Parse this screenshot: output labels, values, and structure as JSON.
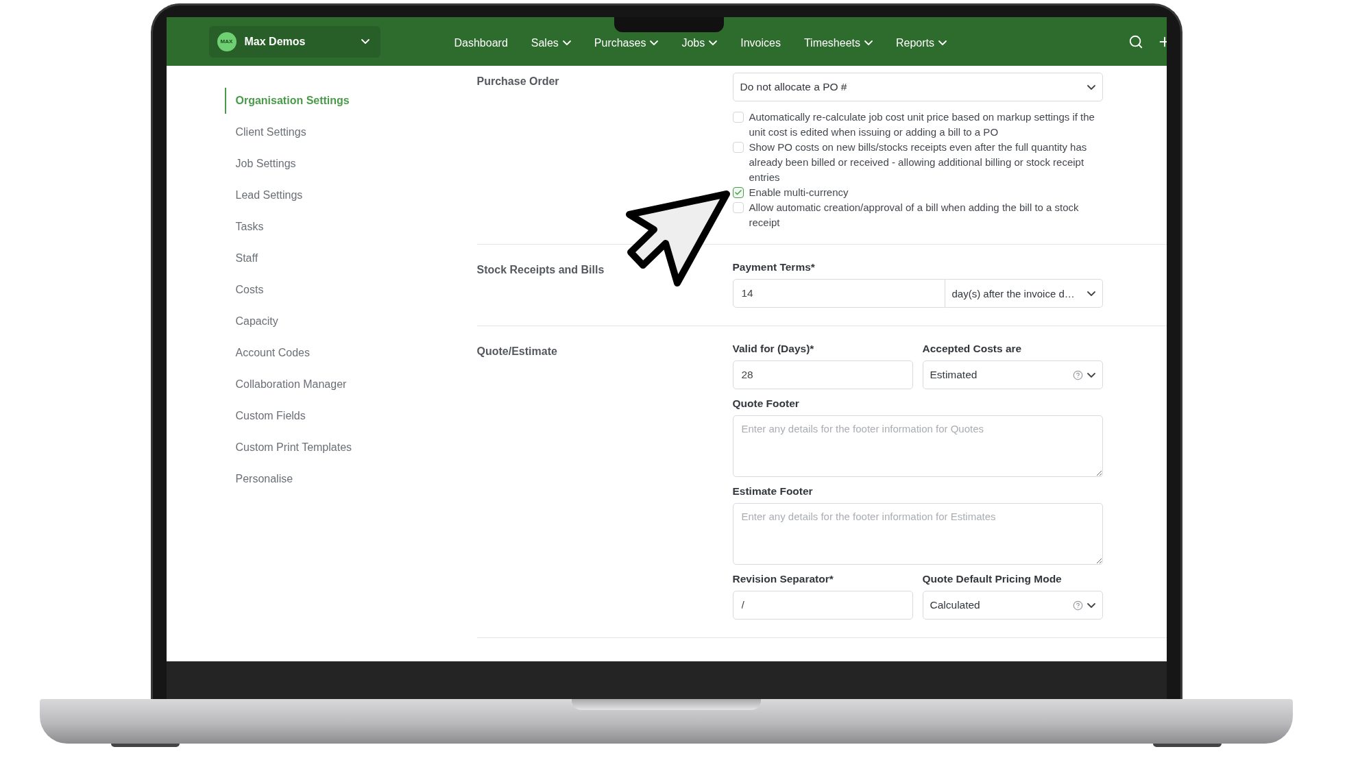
{
  "topbar": {
    "org_switcher": {
      "logo_text": "MAX",
      "name": "Max Demos"
    },
    "nav": [
      {
        "label": "Dashboard",
        "dropdown": false,
        "selected": false
      },
      {
        "label": "Sales",
        "dropdown": true,
        "selected": false
      },
      {
        "label": "Purchases",
        "dropdown": true,
        "selected": false
      },
      {
        "label": "Jobs",
        "dropdown": true,
        "selected": false
      },
      {
        "label": "Invoices",
        "dropdown": false,
        "selected": false
      },
      {
        "label": "Timesheets",
        "dropdown": true,
        "selected": false
      },
      {
        "label": "Reports",
        "dropdown": true,
        "selected": false
      }
    ]
  },
  "sidebar": {
    "items": [
      {
        "label": "Organisation Settings",
        "selected": true
      },
      {
        "label": "Client Settings",
        "selected": false
      },
      {
        "label": "Job Settings",
        "selected": false
      },
      {
        "label": "Lead Settings",
        "selected": false
      },
      {
        "label": "Tasks",
        "selected": false
      },
      {
        "label": "Staff",
        "selected": false
      },
      {
        "label": "Costs",
        "selected": false
      },
      {
        "label": "Capacity",
        "selected": false
      },
      {
        "label": "Account Codes",
        "selected": false
      },
      {
        "label": "Collaboration Manager",
        "selected": false
      },
      {
        "label": "Custom Fields",
        "selected": false
      },
      {
        "label": "Custom Print Templates",
        "selected": false
      },
      {
        "label": "Personalise",
        "selected": false
      }
    ]
  },
  "sections": [
    {
      "title": "Purchase Order",
      "rows": [
        [
          {
            "kind": "select",
            "value": "Do not allocate a PO #"
          }
        ],
        [
          {
            "kind": "checkbox",
            "label": "Automatically re-calculate job cost unit price based on markup settings if the unit cost is edited when issuing or adding a bill to a PO",
            "checked": false
          }
        ],
        [
          {
            "kind": "checkbox",
            "label": "Show PO costs on new bills/stocks receipts even after the full quantity has already been billed or received - allowing additional billing or stock receipt entries",
            "checked": false
          }
        ],
        [
          {
            "kind": "checkbox",
            "label": "Enable multi-currency",
            "checked": true
          }
        ],
        [
          {
            "kind": "checkbox",
            "label": "Allow automatic creation/approval of a bill when adding the bill to a stock receipt",
            "checked": false
          }
        ]
      ]
    },
    {
      "title": "Stock Receipts and Bills",
      "rows": [
        [
          {
            "kind": "compound",
            "label": "Payment Terms*",
            "value": "14",
            "unit": "day(s) after the invoice d…"
          }
        ]
      ]
    },
    {
      "title": "Quote/Estimate",
      "rows": [
        [
          {
            "kind": "input",
            "label": "Valid for (Days)*",
            "value": "28"
          },
          {
            "kind": "select",
            "label": "Accepted Costs are",
            "value": "Estimated",
            "help": true
          }
        ],
        [
          {
            "kind": "textarea",
            "label": "Quote Footer",
            "placeholder": "Enter any details for the footer information for Quotes"
          }
        ],
        [
          {
            "kind": "textarea",
            "label": "Estimate Footer",
            "placeholder": "Enter any details for the footer information for Estimates"
          }
        ],
        [
          {
            "kind": "input",
            "label": "Revision Separator*",
            "value": "/"
          },
          {
            "kind": "select",
            "label": "Quote Default Pricing Mode",
            "value": "Calculated",
            "help": true
          }
        ]
      ]
    }
  ]
}
